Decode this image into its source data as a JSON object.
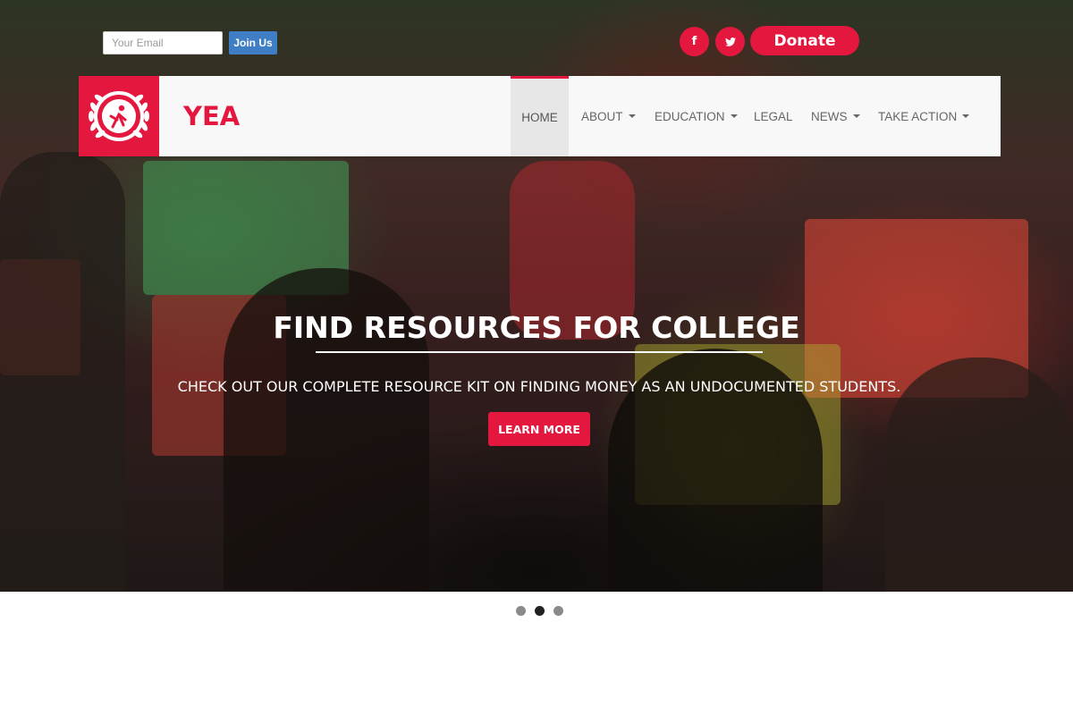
{
  "signup": {
    "email_placeholder": "Your Email",
    "join_label": "Join Us"
  },
  "social": {
    "facebook_glyph": "f",
    "twitter_glyph": "🐦"
  },
  "donate_label": "Donate",
  "brand": {
    "name": "YEA",
    "logo_icon": "laurel-wreath-icon"
  },
  "nav": {
    "items": [
      {
        "label": "HOME",
        "active": true,
        "dropdown": false
      },
      {
        "label": "ABOUT",
        "active": false,
        "dropdown": true
      },
      {
        "label": "EDUCATION",
        "active": false,
        "dropdown": true
      },
      {
        "label": "LEGAL",
        "active": false,
        "dropdown": false
      },
      {
        "label": "NEWS",
        "active": false,
        "dropdown": true
      },
      {
        "label": "TAKE ACTION",
        "active": false,
        "dropdown": true
      }
    ]
  },
  "slide": {
    "title": "FIND RESOURCES FOR COLLEGE",
    "description": "CHECK OUT OUR COMPLETE RESOURCE KIT ON FINDING MONEY AS AN UNDOCUMENTED STUDENTS.",
    "button_label": "LEARN MORE"
  },
  "carousel": {
    "slide_count": 3,
    "active_index": 1
  },
  "colors": {
    "accent": "#e4173e",
    "join_button": "#3f7dc4",
    "navbar_bg": "#f8f8f8"
  }
}
